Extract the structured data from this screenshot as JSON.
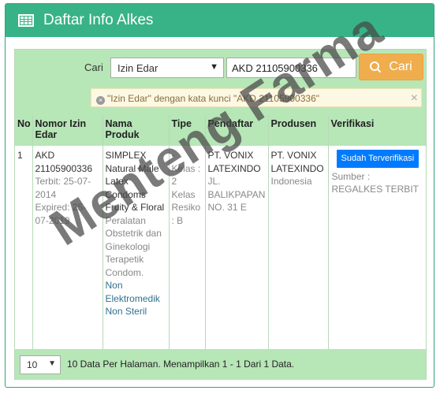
{
  "header": {
    "title": "Daftar Info Alkes",
    "icon": "table-grid-icon"
  },
  "search": {
    "label": "Cari",
    "field_selected": "Izin Edar",
    "query_value": "AKD 21105900336",
    "button_label": "Cari",
    "filter_text": "\"Izin Edar\" dengan kata kunci \"AKD 21105900336\"",
    "close_symbol": "×",
    "tag_remove_symbol": "×"
  },
  "table": {
    "columns": [
      "No",
      "Nomor Izin Edar",
      "Nama Produk",
      "Tipe",
      "Pendaftar",
      "Produsen",
      "Verifikasi"
    ],
    "rows": [
      {
        "no": "1",
        "nomor": "AKD 21105900336",
        "terbit": "Terbit: 25-07-2014",
        "expired": "Expired: 25-07-2019",
        "nama_produk": "SIMPLEX Natural Male Latex Condoms Fruity & Floral",
        "kategori": "Peralatan Obstetrik dan Ginekologi Terapetik Condom.",
        "sub_kategori": "Non Elektromedik Non Steril",
        "tipe_dash": "-",
        "tipe_kelas": "Kelas : 2",
        "tipe_resiko": "Kelas Resiko : B",
        "pendaftar_nama": "PT. VONIX LATEXINDO",
        "pendaftar_alamat": "JL. BALIKPAPAN NO. 31 E",
        "produsen_nama": "PT. VONIX LATEXINDO",
        "produsen_negara": "Indonesia",
        "verifikasi_badge": "Sudah Terverifikasi",
        "sumber": "Sumber : REGALKES TERBIT"
      }
    ]
  },
  "footer": {
    "per_page_value": "10",
    "info": "10 Data Per Halaman. Menampilkan 1 - 1 Dari 1 Data."
  },
  "watermark": "Menteng Farma",
  "colors": {
    "header_green": "#38b387",
    "light_green": "#b7e6b7",
    "button_orange": "#f0ad4e",
    "badge_blue": "#007bff"
  }
}
